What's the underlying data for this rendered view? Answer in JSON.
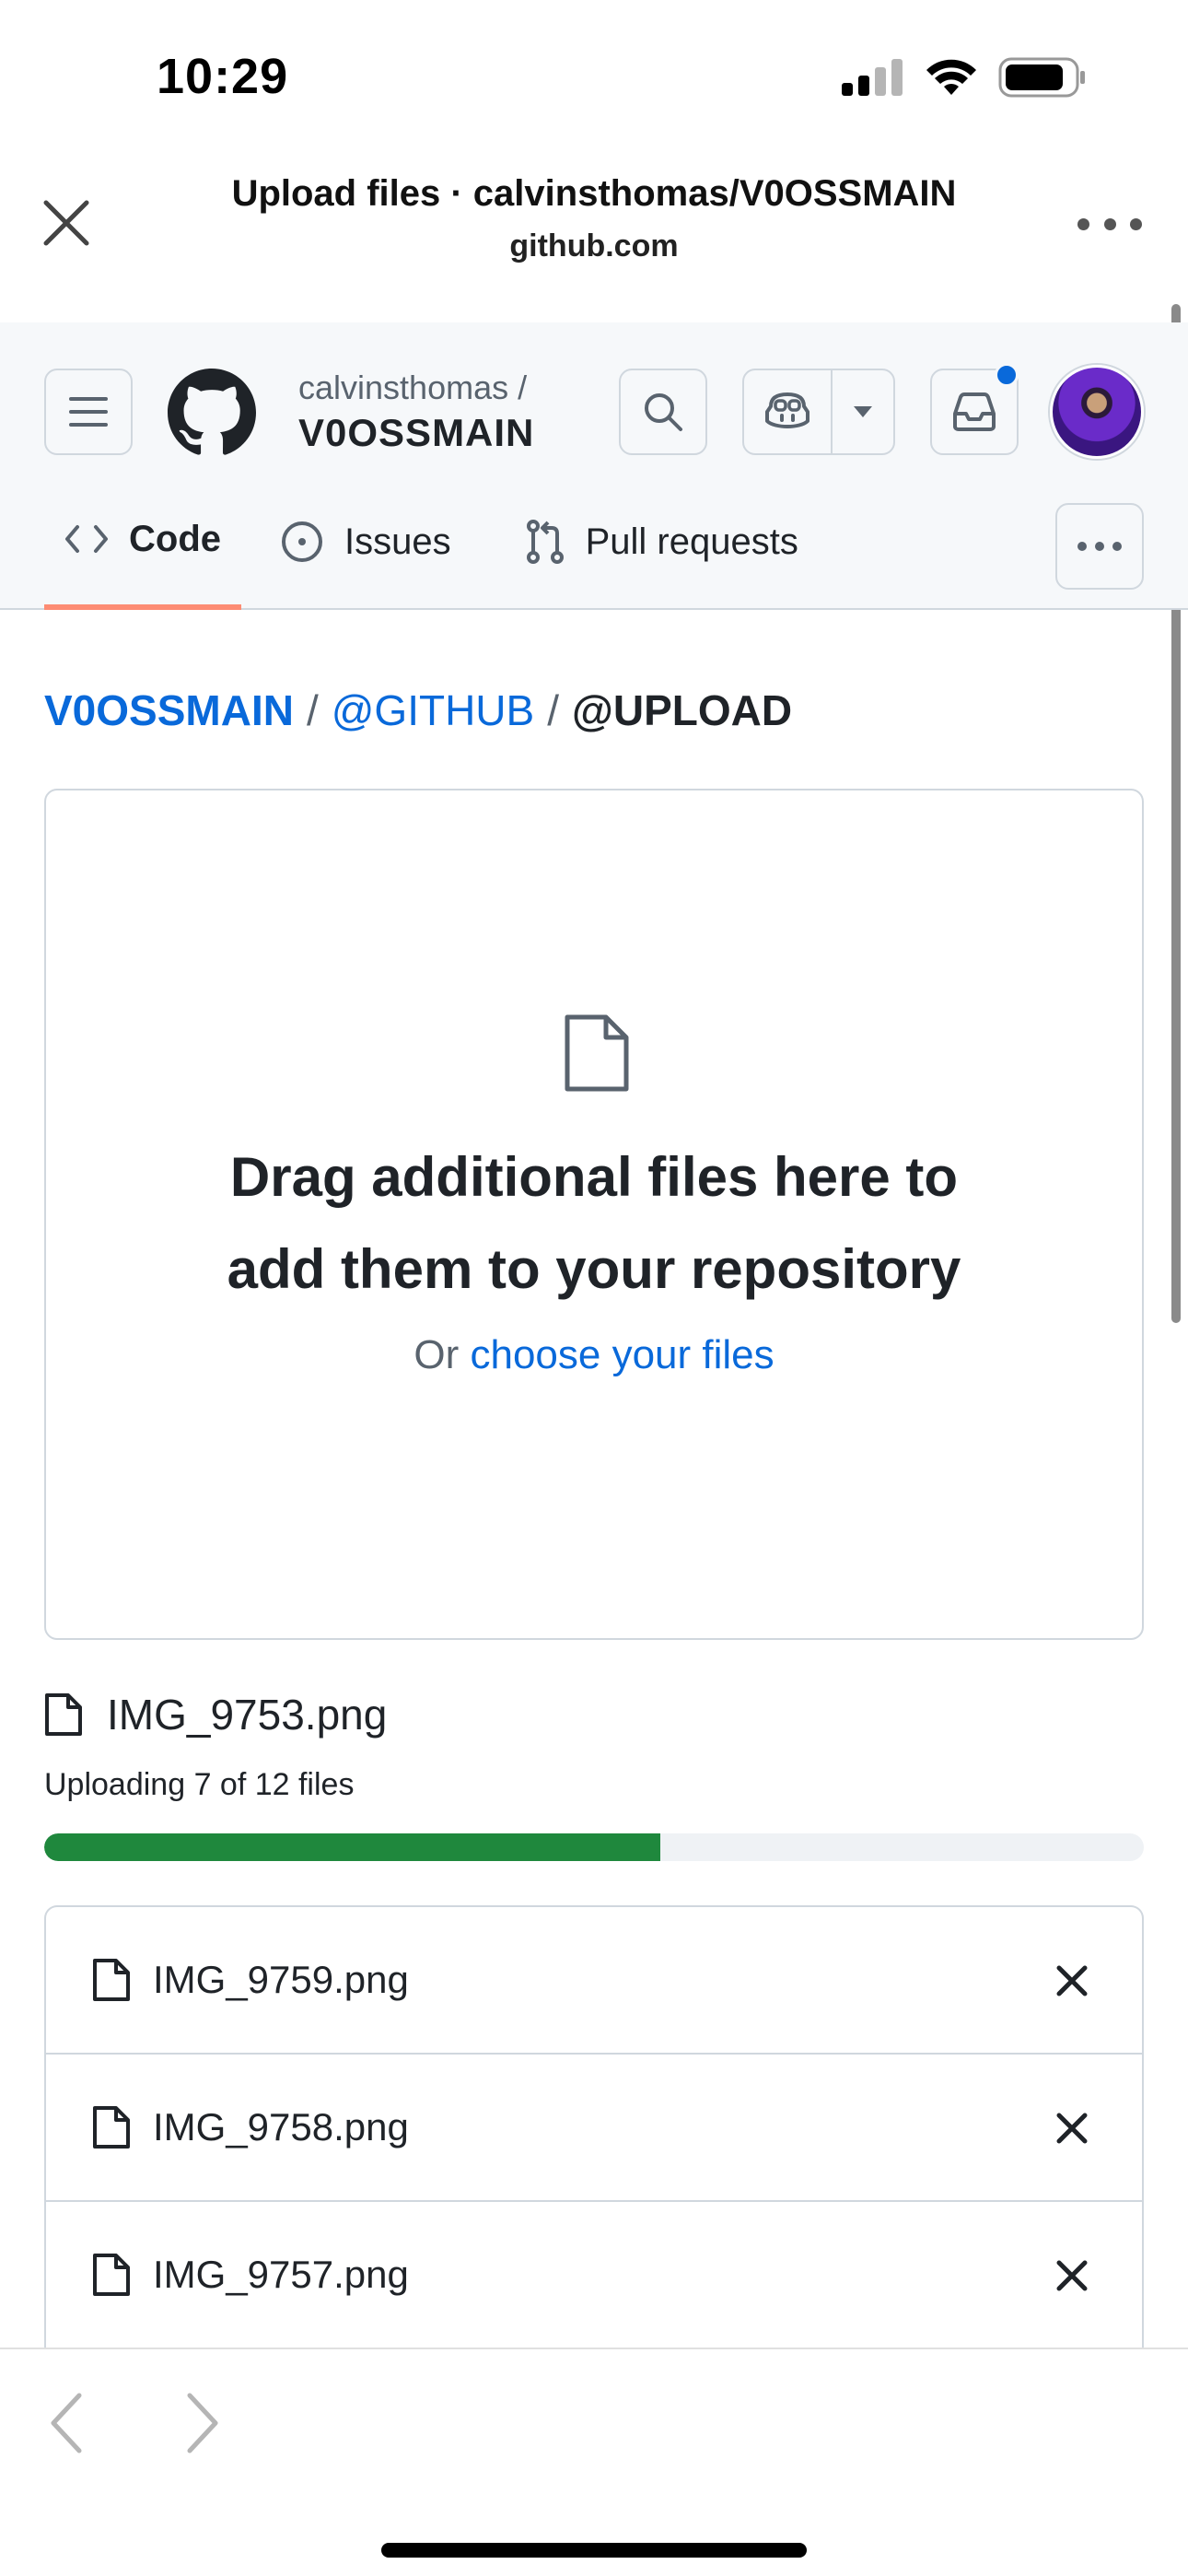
{
  "status_bar": {
    "time": "10:29"
  },
  "browser": {
    "title": "Upload files · calvinsthomas/V0OSSMAIN",
    "host": "github.com"
  },
  "header": {
    "owner": "calvinsthomas /",
    "repo": "V0OSSMAIN",
    "has_notification": true
  },
  "tabs": [
    {
      "label": "Code",
      "icon": "code-icon",
      "selected": true
    },
    {
      "label": "Issues",
      "icon": "issue-opened-icon",
      "selected": false
    },
    {
      "label": "Pull requests",
      "icon": "git-pull-request-icon",
      "selected": false
    }
  ],
  "breadcrumb": {
    "repo": "V0OSSMAIN",
    "folder": "@GITHUB",
    "current": "@UPLOAD",
    "separator": "/"
  },
  "dropzone": {
    "title_line1": "Drag additional files here to",
    "title_line2": "add them to your repository",
    "prefix": "Or",
    "link": "choose your files"
  },
  "upload": {
    "current_file": "IMG_9753.png",
    "status": "Uploading 7 of 12 files",
    "progress": 0.56
  },
  "files": [
    {
      "name": "IMG_9759.png"
    },
    {
      "name": "IMG_9758.png"
    },
    {
      "name": "IMG_9757.png"
    }
  ],
  "colors": {
    "link": "#0969da",
    "progress": "#1f883d",
    "tab_underline": "#fd8c73",
    "notification": "#0969da"
  }
}
